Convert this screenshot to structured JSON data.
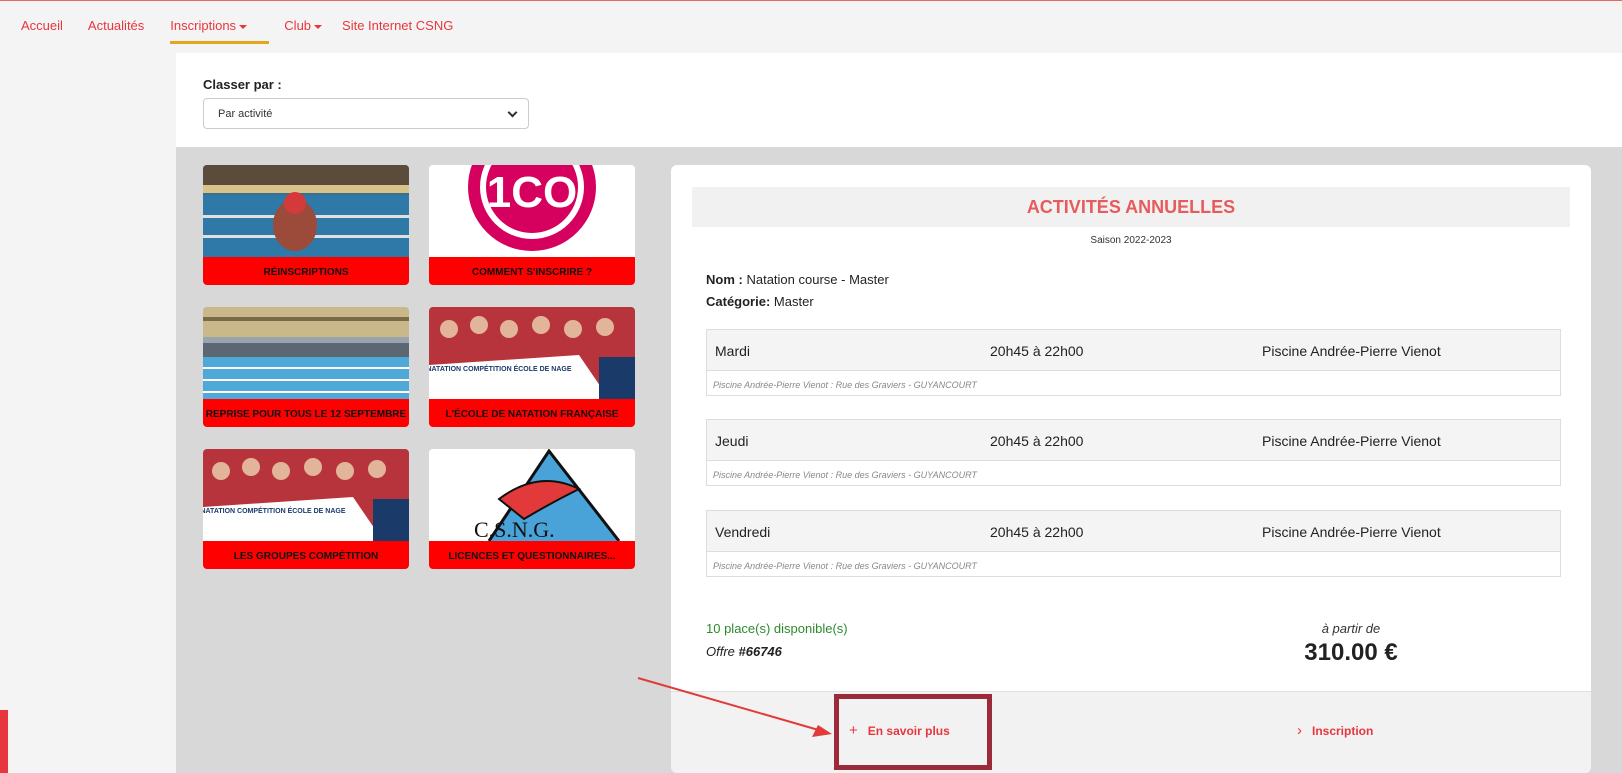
{
  "nav": {
    "items": [
      {
        "label": "Accueil"
      },
      {
        "label": "Actualités"
      },
      {
        "label": "Inscriptions"
      },
      {
        "label": "Club"
      },
      {
        "label": "Site Internet CSNG"
      }
    ]
  },
  "sort": {
    "label": "Classer par :",
    "selected": "Par activité"
  },
  "tiles": [
    {
      "label": "RÉINSCRIPTIONS"
    },
    {
      "label": "COMMENT S'INSCRIRE ?",
      "logo_text": "1CO"
    },
    {
      "label": "REPRISE POUR TOUS LE 12 SEPTEMBRE"
    },
    {
      "label": "L'ÉCOLE DE NATATION FRANÇAISE",
      "banner_text": "NATATION COMPÉTITION ÉCOLE DE NAGE"
    },
    {
      "label": "LES GROUPES COMPÉTITION",
      "banner_text": "NATATION COMPÉTITION ÉCOLE DE NAGE"
    },
    {
      "label": "LICENCES ET QUESTIONNAIRES...",
      "logo_text": "C.S.N.G."
    }
  ],
  "card": {
    "title": "ACTIVITÉS ANNUELLES",
    "season": "Saison 2022-2023",
    "nom_label": "Nom :",
    "nom_value": "Natation course - Master",
    "cat_label": "Catégorie:",
    "cat_value": "Master",
    "schedules": [
      {
        "day": "Mardi",
        "time": "20h45 à 22h00",
        "place": "Piscine Andrée-Pierre Vienot",
        "address": "Piscine Andrée-Pierre Vienot : Rue des Graviers - GUYANCOURT"
      },
      {
        "day": "Jeudi",
        "time": "20h45 à 22h00",
        "place": "Piscine Andrée-Pierre Vienot",
        "address": "Piscine Andrée-Pierre Vienot : Rue des Graviers - GUYANCOURT"
      },
      {
        "day": "Vendredi",
        "time": "20h45 à 22h00",
        "place": "Piscine Andrée-Pierre Vienot",
        "address": "Piscine Andrée-Pierre Vienot : Rue des Graviers - GUYANCOURT"
      }
    ],
    "availability": "10 place(s) disponible(s)",
    "offer_label": "Offre ",
    "offer_number": "#66746",
    "price_from": "à partir de",
    "price": "310.00 €",
    "more_label": "En savoir plus",
    "more_icon": "+",
    "register_label": "Inscription",
    "register_icon": "›"
  },
  "colors": {
    "accent": "#e8363f",
    "tile_label_bg": "#ff0000",
    "title": "#e75b5b",
    "available": "#2d8a2d",
    "highlight": "#9b2a3a"
  }
}
